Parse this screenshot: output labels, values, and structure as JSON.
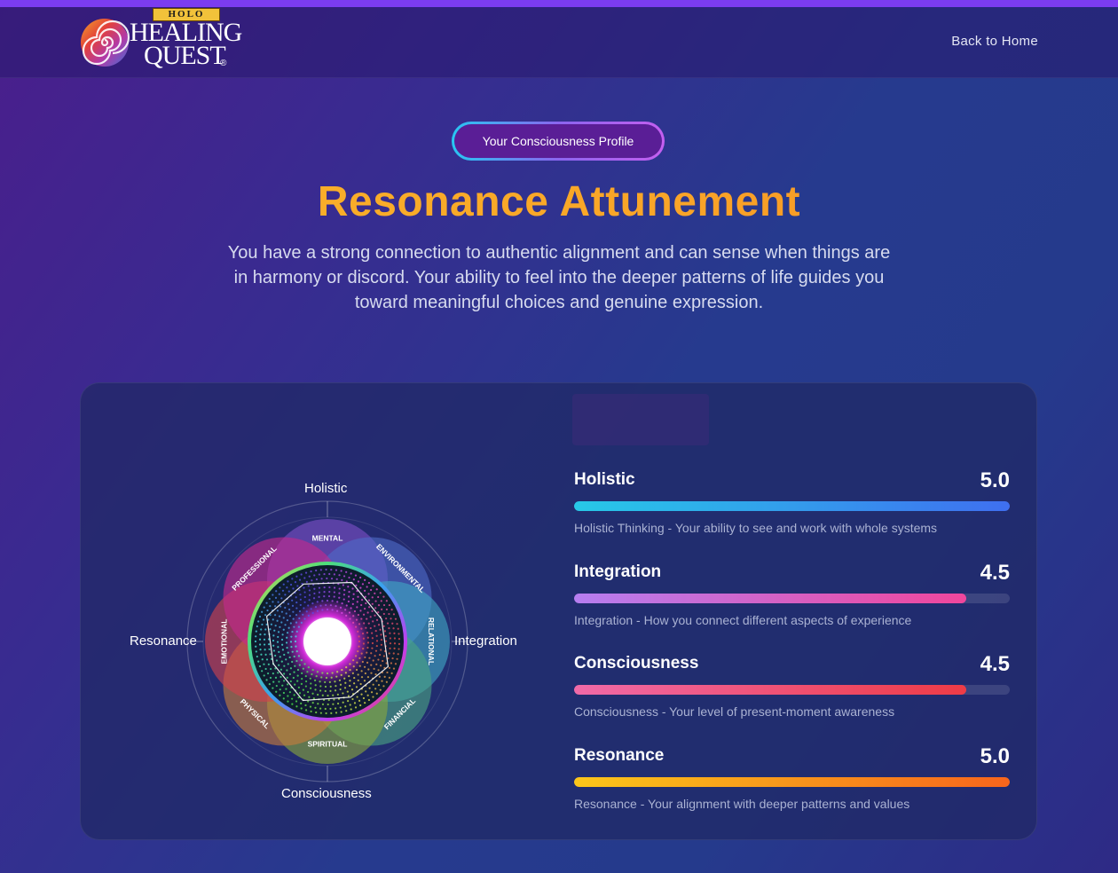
{
  "brand": {
    "badge": "HOLO",
    "line1": "HEALING",
    "line2": "QUEST",
    "registered": "®"
  },
  "nav": {
    "back_home": "Back to Home"
  },
  "hero": {
    "pill": "Your Consciousness Profile",
    "title": "Resonance Attunement",
    "description": "You have a strong connection to authentic alignment and can sense when things are in harmony or discord. Your ability to feel into the deeper patterns of life guides you toward meaningful choices and genuine expression."
  },
  "radar": {
    "axes": {
      "top": "Holistic",
      "right": "Integration",
      "bottom": "Consciousness",
      "left": "Resonance"
    },
    "petals": [
      {
        "label": "MENTAL",
        "color": "#7d4fc7"
      },
      {
        "label": "ENVIRONMENTAL",
        "color": "#4d6bc7"
      },
      {
        "label": "RELATIONAL",
        "color": "#3fa6c4"
      },
      {
        "label": "FINANCIAL",
        "color": "#4aa383"
      },
      {
        "label": "SPIRITUAL",
        "color": "#88a63d"
      },
      {
        "label": "PHYSICAL",
        "color": "#c77d3e"
      },
      {
        "label": "EMOTIONAL",
        "color": "#d1424e"
      },
      {
        "label": "PROFESSIONAL",
        "color": "#c42a8c"
      }
    ]
  },
  "chart_data": {
    "type": "bar",
    "categories": [
      "Holistic",
      "Integration",
      "Consciousness",
      "Resonance"
    ],
    "values": [
      5.0,
      4.5,
      4.5,
      5.0
    ],
    "ylim": [
      0,
      5
    ]
  },
  "metrics": [
    {
      "name": "Holistic",
      "score": "5.0",
      "value": 5.0,
      "description": "Holistic Thinking - Your ability to see and work with whole systems",
      "gradient": [
        "#27c9e8",
        "#3f6ff0"
      ]
    },
    {
      "name": "Integration",
      "score": "4.5",
      "value": 4.5,
      "description": "Integration - How you connect different aspects of experience",
      "gradient": [
        "#b67ef0",
        "#f0469c"
      ]
    },
    {
      "name": "Consciousness",
      "score": "4.5",
      "value": 4.5,
      "description": "Consciousness - Your level of present-moment awareness",
      "gradient": [
        "#f06aa8",
        "#ee3b46"
      ]
    },
    {
      "name": "Resonance",
      "score": "5.0",
      "value": 5.0,
      "description": "Resonance - Your alignment with deeper patterns and values",
      "gradient": [
        "#fbc61a",
        "#f7651c"
      ]
    }
  ]
}
